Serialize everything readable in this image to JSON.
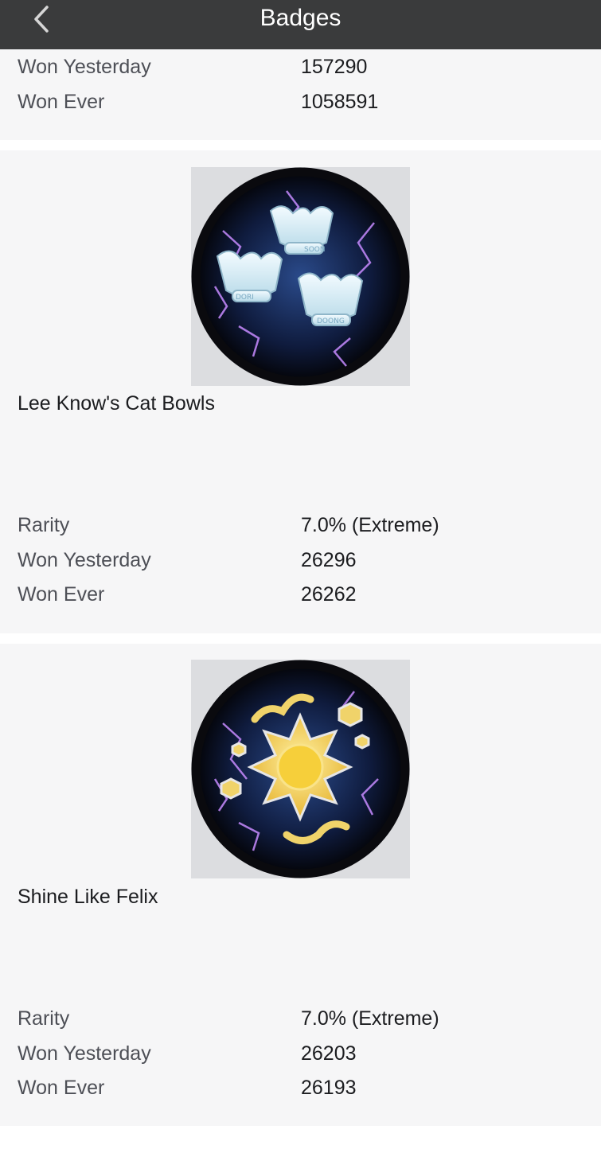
{
  "header": {
    "title": "Badges"
  },
  "cards": [
    {
      "stats": [
        {
          "label": "Won Yesterday",
          "value": "157290"
        },
        {
          "label": "Won Ever",
          "value": "1058591"
        }
      ]
    },
    {
      "name": "Lee Know's Cat Bowls",
      "image_text": [
        "SOON",
        "DORI",
        "DOONG"
      ],
      "stats": [
        {
          "label": "Rarity",
          "value": "7.0% (Extreme)"
        },
        {
          "label": "Won Yesterday",
          "value": "26296"
        },
        {
          "label": "Won Ever",
          "value": "26262"
        }
      ]
    },
    {
      "name": "Shine Like Felix",
      "stats": [
        {
          "label": "Rarity",
          "value": "7.0% (Extreme)"
        },
        {
          "label": "Won Yesterday",
          "value": "26203"
        },
        {
          "label": "Won Ever",
          "value": "26193"
        }
      ]
    }
  ]
}
